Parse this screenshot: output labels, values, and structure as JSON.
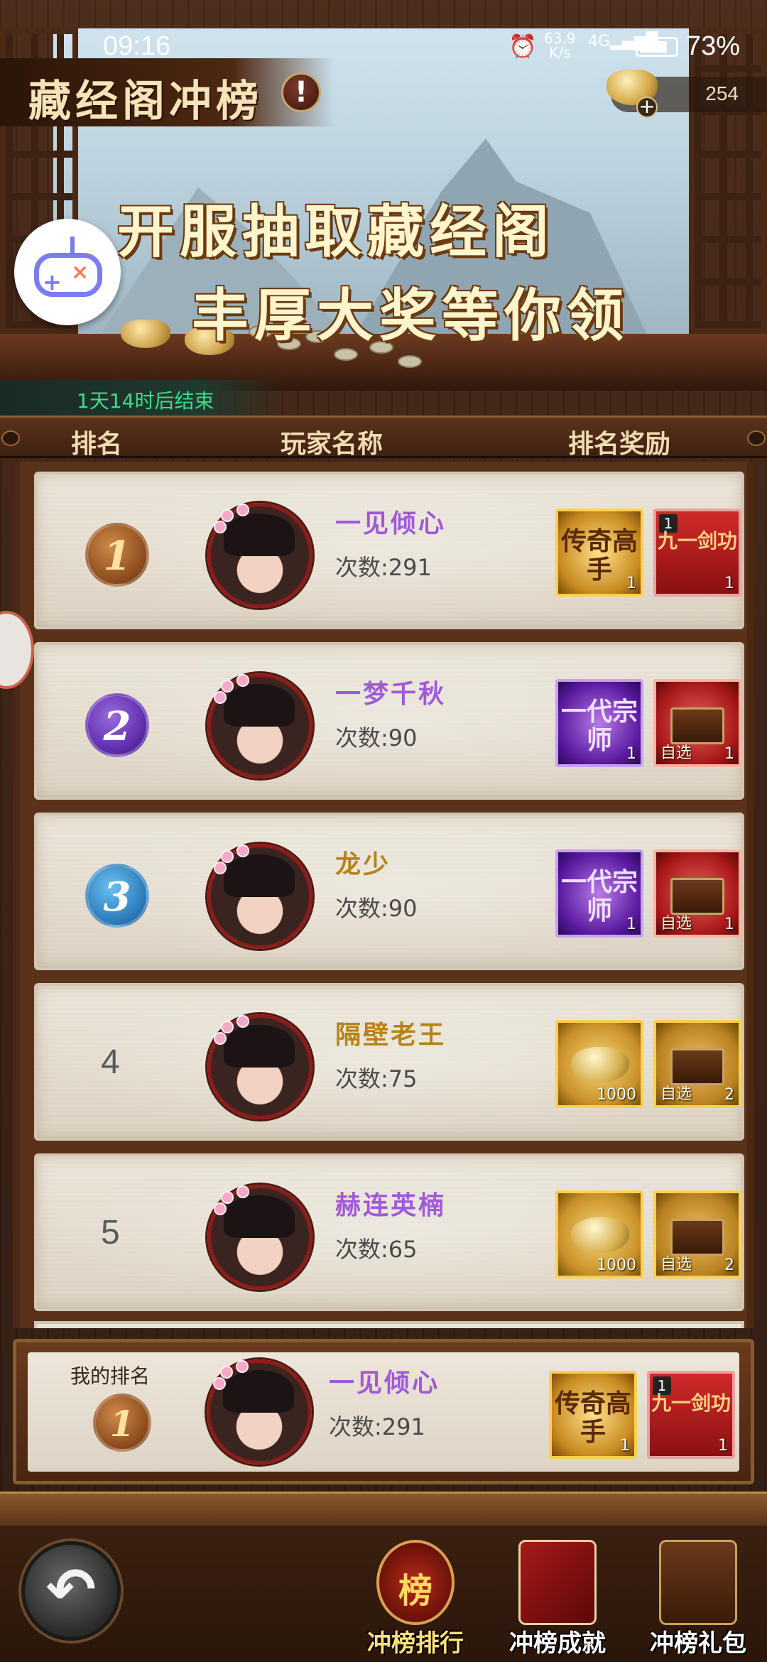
{
  "status_bar": {
    "time": "09:16",
    "net_speed": "63.9",
    "net_unit": "K/s",
    "network": "4G",
    "battery": "73%"
  },
  "header": {
    "title": "藏经阁冲榜",
    "alert_icon": "!",
    "currency_value": "254",
    "slogan_line1": "开服抽取藏经阁",
    "slogan_line2": "丰厚大奖等你领",
    "countdown": "1天14时后结束"
  },
  "columns": {
    "rank": "排名",
    "player": "玩家名称",
    "reward": "排名奖励"
  },
  "count_prefix": "次数:",
  "rankings": [
    {
      "rank": "1",
      "medal": "gold",
      "name": "一见倾心",
      "name_color": "purple",
      "count": "291",
      "rewards": [
        {
          "type": "legend",
          "glyph": "传奇高手",
          "qty": "1"
        },
        {
          "type": "scroll",
          "glyph": "九一剑功",
          "qty": "1",
          "corner": "1"
        }
      ]
    },
    {
      "rank": "2",
      "medal": "purple",
      "name": "一梦千秋",
      "name_color": "purple",
      "count": "90",
      "rewards": [
        {
          "type": "master",
          "glyph": "一代宗师",
          "qty": "1"
        },
        {
          "type": "chest",
          "tag": "自选",
          "qty": "1"
        }
      ]
    },
    {
      "rank": "3",
      "medal": "blue",
      "name": "龙少",
      "name_color": "gold",
      "count": "90",
      "rewards": [
        {
          "type": "master",
          "glyph": "一代宗师",
          "qty": "1"
        },
        {
          "type": "chest",
          "tag": "自选",
          "qty": "1"
        }
      ]
    },
    {
      "rank": "4",
      "medal": "none",
      "name": "隔壁老王",
      "name_color": "gold",
      "count": "75",
      "rewards": [
        {
          "type": "ingot",
          "qty": "1000"
        },
        {
          "type": "chest-gold",
          "tag": "自选",
          "qty": "2"
        }
      ]
    },
    {
      "rank": "5",
      "medal": "none",
      "name": "赫连英楠",
      "name_color": "purple",
      "count": "65",
      "rewards": [
        {
          "type": "ingot",
          "qty": "1000"
        },
        {
          "type": "chest-gold",
          "tag": "自选",
          "qty": "2"
        }
      ]
    }
  ],
  "my_rank": {
    "label": "我的排名",
    "rank": "1",
    "name": "一见倾心",
    "count": "291",
    "reward1_glyph": "传奇高手",
    "reward1_qty": "1",
    "reward2_glyph": "九一剑功",
    "reward2_qty": "1",
    "reward2_corner": "1"
  },
  "nav": {
    "back_icon": "↶",
    "tab1_label": "冲榜排行",
    "tab1_icon_text": "榜",
    "tab2_label": "冲榜成就",
    "tab3_label": "冲榜礼包"
  }
}
